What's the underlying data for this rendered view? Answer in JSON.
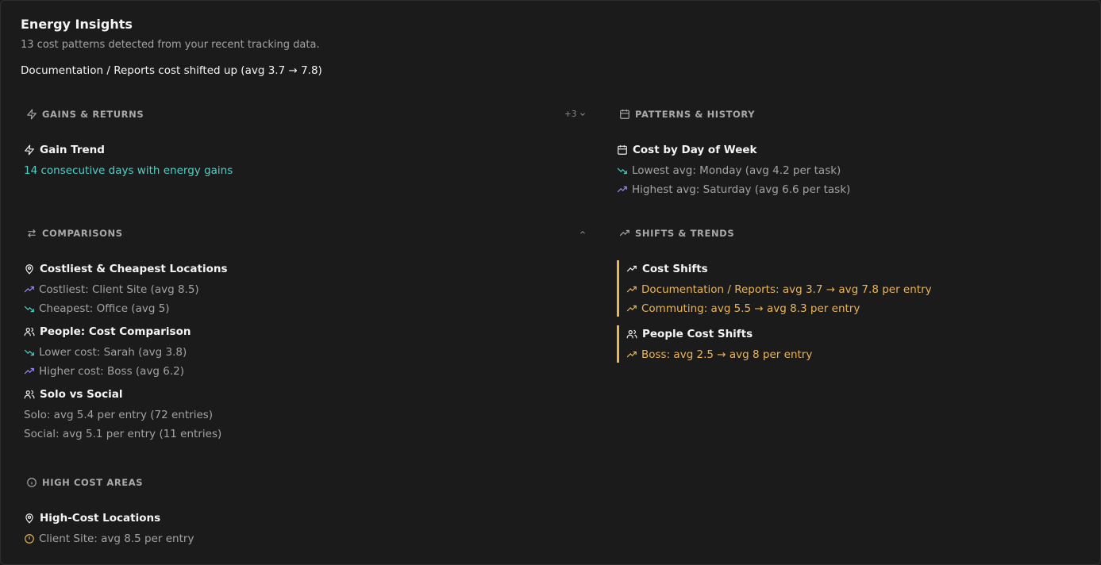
{
  "header": {
    "title": "Energy Insights",
    "subtitle": "13 cost patterns detected from your recent tracking data.",
    "headline": "Documentation / Reports cost shifted up (avg 3.7 → 7.8)"
  },
  "gains": {
    "heading": "GAINS & RETURNS",
    "more_label": "+3",
    "item_title": "Gain Trend",
    "item_text": "14 consecutive days with energy gains"
  },
  "patterns": {
    "heading": "PATTERNS & HISTORY",
    "item_title": "Cost by Day of Week",
    "lowest": "Lowest avg: Monday (avg 4.2 per task)",
    "highest": "Highest avg: Saturday (avg 6.6 per task)"
  },
  "comparisons": {
    "heading": "COMPARISONS",
    "locations_title": "Costliest & Cheapest Locations",
    "costliest": "Costliest: Client Site (avg 8.5)",
    "cheapest": "Cheapest: Office (avg 5)",
    "people_title": "People: Cost Comparison",
    "lower": "Lower cost: Sarah (avg 3.8)",
    "higher": "Higher cost: Boss (avg 6.2)",
    "solo_title": "Solo vs Social",
    "solo": "Solo: avg 5.4 per entry (72 entries)",
    "social": "Social: avg 5.1 per entry (11 entries)"
  },
  "shifts": {
    "heading": "SHIFTS & TRENDS",
    "cost_title": "Cost Shifts",
    "shift1": "Documentation / Reports: avg 3.7 → avg 7.8 per entry",
    "shift2": "Commuting: avg 5.5 → avg 8.3 per entry",
    "people_title": "People Cost Shifts",
    "people_shift1": "Boss: avg 2.5 → avg 8 per entry"
  },
  "high_cost": {
    "heading": "HIGH COST AREAS",
    "item_title": "High-Cost Locations",
    "item_text": "Client Site: avg 8.5 per entry"
  },
  "colors": {
    "background": "#1b1b1b",
    "teal": "#4fd0c4",
    "amber": "#e9b55a",
    "violet": "#9b8cff",
    "muted": "#a3a3a3"
  },
  "icons": [
    "zap-icon",
    "calendar-icon",
    "arrows-exchange-icon",
    "trend-up-icon",
    "trend-down-icon",
    "map-pin-icon",
    "users-icon",
    "info-icon",
    "alert-circle-icon",
    "chevron-down-icon",
    "chevron-up-icon"
  ]
}
